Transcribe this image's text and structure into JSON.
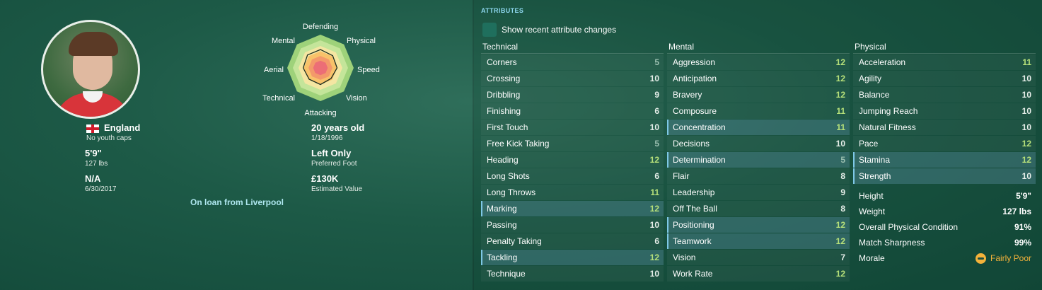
{
  "player": {
    "nationality": "England",
    "youth_caps": "No youth caps",
    "height": "5'9\"",
    "weight": "127 lbs",
    "contract": "N/A",
    "contract_date": "6/30/2017",
    "age": "20 years old",
    "dob": "1/18/1996",
    "foot": "Left Only",
    "foot_label": "Preferred Foot",
    "value": "£130K",
    "value_label": "Estimated Value",
    "loan": "On loan from Liverpool"
  },
  "radar": {
    "labels": [
      "Defending",
      "Physical",
      "Speed",
      "Vision",
      "Attacking",
      "Technical",
      "Aerial",
      "Mental"
    ],
    "colors": [
      "#9ed27a",
      "#c4e59a",
      "#f4e6a2",
      "#f8c26a",
      "#f3996a",
      "#ec6e76"
    ]
  },
  "attributes": {
    "title": "ATTRIBUTES",
    "toggle_label": "Show recent attribute changes",
    "technical": {
      "header": "Technical",
      "rows": [
        {
          "name": "Corners",
          "value": 5
        },
        {
          "name": "Crossing",
          "value": 10
        },
        {
          "name": "Dribbling",
          "value": 9
        },
        {
          "name": "Finishing",
          "value": 6
        },
        {
          "name": "First Touch",
          "value": 10
        },
        {
          "name": "Free Kick Taking",
          "value": 5
        },
        {
          "name": "Heading",
          "value": 12
        },
        {
          "name": "Long Shots",
          "value": 6
        },
        {
          "name": "Long Throws",
          "value": 11
        },
        {
          "name": "Marking",
          "value": 12,
          "hl": true
        },
        {
          "name": "Passing",
          "value": 10
        },
        {
          "name": "Penalty Taking",
          "value": 6
        },
        {
          "name": "Tackling",
          "value": 12,
          "hl": true
        },
        {
          "name": "Technique",
          "value": 10
        }
      ]
    },
    "mental": {
      "header": "Mental",
      "rows": [
        {
          "name": "Aggression",
          "value": 12
        },
        {
          "name": "Anticipation",
          "value": 12
        },
        {
          "name": "Bravery",
          "value": 12
        },
        {
          "name": "Composure",
          "value": 11
        },
        {
          "name": "Concentration",
          "value": 11,
          "hl": true
        },
        {
          "name": "Decisions",
          "value": 10
        },
        {
          "name": "Determination",
          "value": 5,
          "hl": true
        },
        {
          "name": "Flair",
          "value": 8
        },
        {
          "name": "Leadership",
          "value": 9
        },
        {
          "name": "Off The Ball",
          "value": 8
        },
        {
          "name": "Positioning",
          "value": 12,
          "hl": true
        },
        {
          "name": "Teamwork",
          "value": 12,
          "hl": true
        },
        {
          "name": "Vision",
          "value": 7
        },
        {
          "name": "Work Rate",
          "value": 12
        }
      ]
    },
    "physical": {
      "header": "Physical",
      "rows": [
        {
          "name": "Acceleration",
          "value": 11
        },
        {
          "name": "Agility",
          "value": 10
        },
        {
          "name": "Balance",
          "value": 10
        },
        {
          "name": "Jumping Reach",
          "value": 10
        },
        {
          "name": "Natural Fitness",
          "value": 10
        },
        {
          "name": "Pace",
          "value": 12
        },
        {
          "name": "Stamina",
          "value": 12,
          "hl": true
        },
        {
          "name": "Strength",
          "value": 10,
          "hl": true
        }
      ],
      "extra": [
        {
          "name": "Height",
          "value": "5'9\""
        },
        {
          "name": "Weight",
          "value": "127 lbs"
        },
        {
          "name": "Overall Physical Condition",
          "value": "91%"
        },
        {
          "name": "Match Sharpness",
          "value": "99%"
        }
      ],
      "morale_label": "Morale",
      "morale_value": "Fairly Poor"
    }
  }
}
